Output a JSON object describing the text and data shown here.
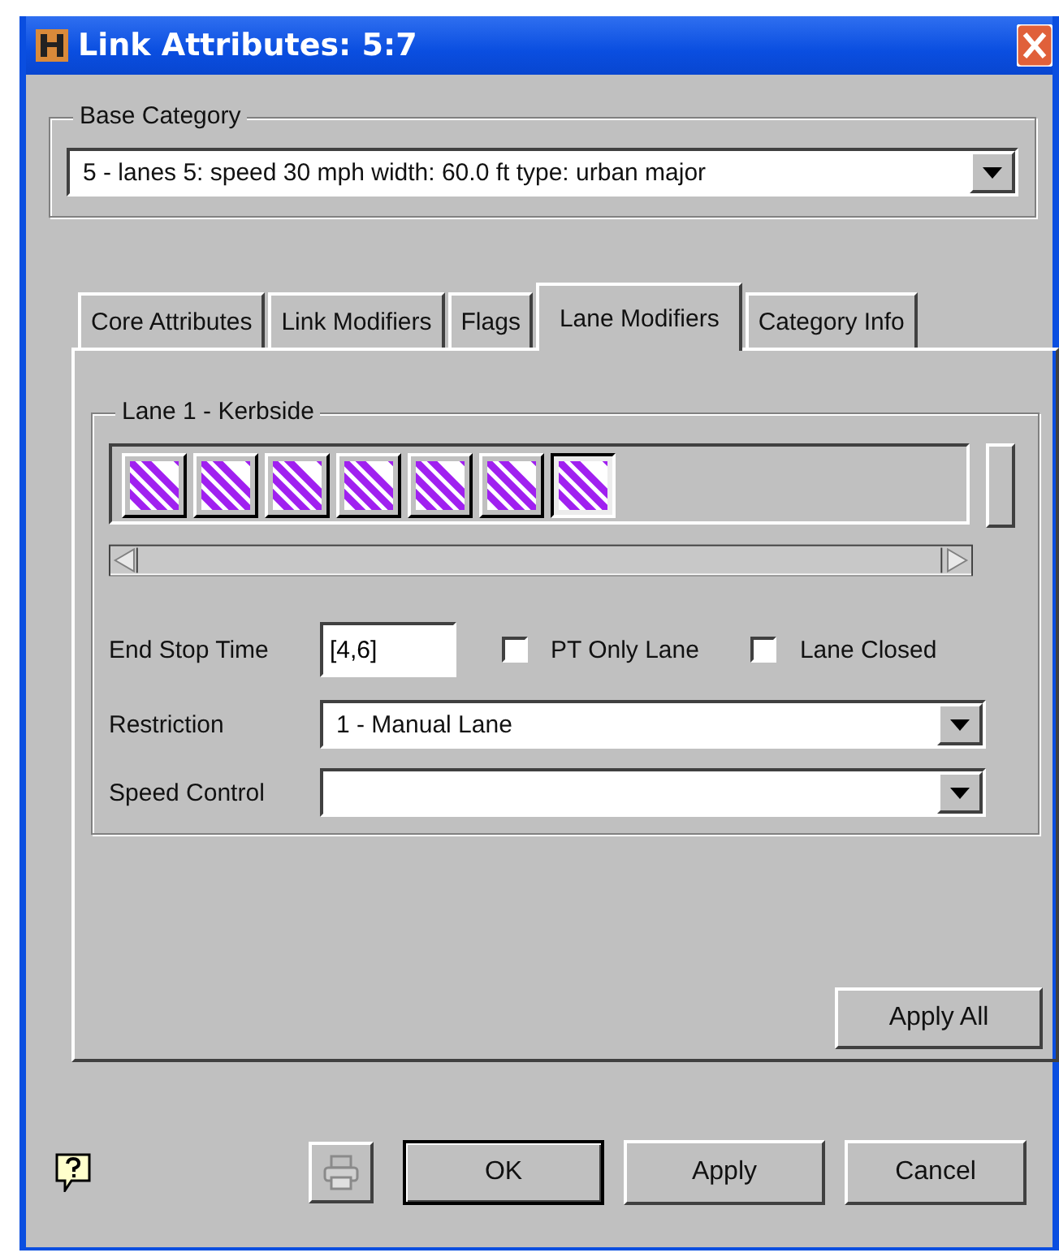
{
  "window": {
    "title": "Link Attributes: 5:7"
  },
  "base_category": {
    "label": "Base Category",
    "value": "5  -  lanes 5: speed 30 mph width: 60.0 ft type: urban major"
  },
  "tabs": [
    {
      "label": "Core Attributes",
      "selected": false
    },
    {
      "label": "Link Modifiers",
      "selected": false
    },
    {
      "label": "Flags",
      "selected": false
    },
    {
      "label": "Lane Modifiers",
      "selected": true
    },
    {
      "label": "Category Info",
      "selected": false
    }
  ],
  "lane_group": {
    "label": "Lane 1 - Kerbside",
    "lanes": [
      {
        "selected": false
      },
      {
        "selected": false
      },
      {
        "selected": false
      },
      {
        "selected": false
      },
      {
        "selected": false
      },
      {
        "selected": false
      },
      {
        "selected": true
      }
    ],
    "end_stop_time": {
      "label": "End Stop Time",
      "value": "[4,6]"
    },
    "checkboxes": [
      {
        "label": "PT Only Lane",
        "checked": false
      },
      {
        "label": "Lane Closed",
        "checked": false
      }
    ],
    "restriction": {
      "label": "Restriction",
      "value": "1 - Manual Lane"
    },
    "speed_control": {
      "label": "Speed Control"
    }
  },
  "apply_all": "Apply All",
  "buttons": [
    {
      "label": "OK",
      "default": true
    },
    {
      "label": "Apply",
      "default": false
    },
    {
      "label": "Cancel",
      "default": false
    }
  ]
}
